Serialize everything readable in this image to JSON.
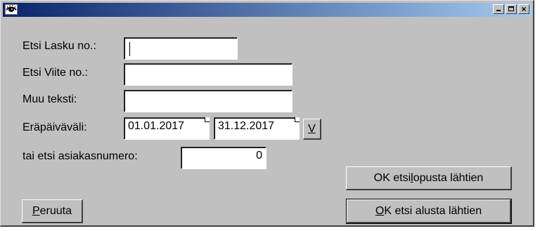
{
  "window": {
    "title": "",
    "controls": {
      "minimize": "_",
      "maximize": "□",
      "close": "×"
    }
  },
  "form": {
    "invoice_label": "Etsi Lasku no.:",
    "invoice_value": "",
    "reference_label": "Etsi Viite no.:",
    "reference_value": "",
    "other_text_label": "Muu teksti:",
    "other_text_value": "",
    "due_range_label": "Eräpäiväväli:",
    "date_from": "01.01.2017",
    "date_to": "31.12.2017",
    "v_button_label": "V",
    "customer_label": "tai etsi asiakasnumero:",
    "customer_value": "0"
  },
  "buttons": {
    "ok_from_end_prefix": "OK etsi ",
    "ok_from_end_hotkey": "l",
    "ok_from_end_suffix": "opusta lähtien",
    "ok_from_start_hotkey": "O",
    "ok_from_start_suffix": "K etsi alusta lähtien",
    "cancel_hotkey": "P",
    "cancel_suffix": "eruuta"
  },
  "icons": {
    "app_icon": "eye-icon"
  }
}
